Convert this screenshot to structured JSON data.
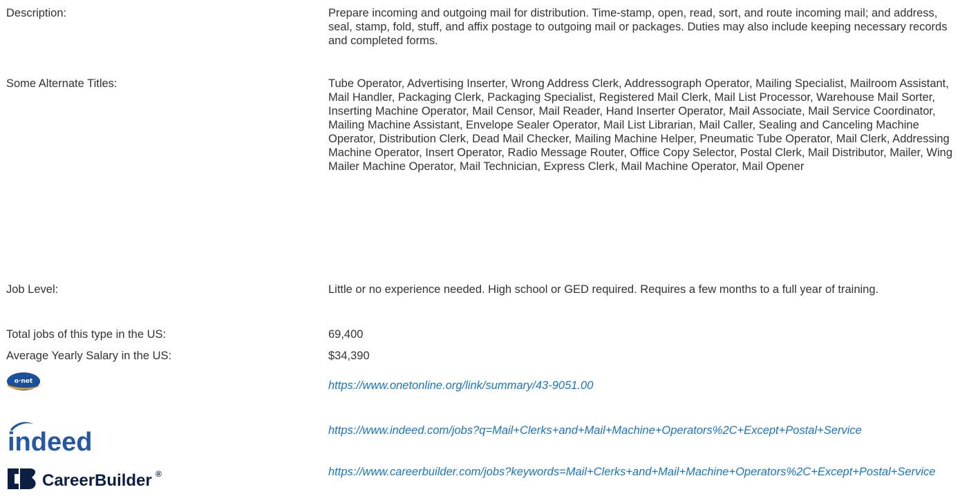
{
  "rows": {
    "description": {
      "label": "Description:",
      "value": "Prepare incoming and outgoing mail for distribution. Time-stamp, open, read, sort, and route incoming mail; and address, seal, stamp, fold, stuff, and affix postage to outgoing mail or packages. Duties may also include keeping necessary records and completed forms."
    },
    "alternate_titles": {
      "label": "Some Alternate Titles:",
      "value": "Tube Operator, Advertising Inserter, Wrong Address Clerk, Addressograph Operator, Mailing Specialist, Mailroom Assistant, Mail Handler, Packaging Clerk, Packaging Specialist, Registered Mail Clerk, Mail List Processor, Warehouse Mail Sorter, Inserting Machine Operator, Mail Censor, Mail Reader, Hand Inserter Operator, Mail Associate, Mail Service Coordinator, Mailing Machine Assistant, Envelope Sealer Operator, Mail List Librarian, Mail Caller, Sealing and Canceling Machine Operator, Distribution Clerk, Dead Mail Checker, Mailing Machine Helper, Pneumatic Tube Operator, Mail Clerk, Addressing Machine Operator, Insert Operator, Radio Message Router, Office Copy Selector, Postal Clerk, Mail Distributor, Mailer, Wing Mailer Machine Operator, Mail Technician, Express Clerk, Mail Machine Operator, Mail Opener"
    },
    "job_level": {
      "label": "Job Level:",
      "value": "Little or no experience needed. High school or GED required. Requires a few months to a full year of training."
    },
    "total_jobs": {
      "label": "Total jobs of this type in the US:",
      "value": "69,400"
    },
    "salary": {
      "label": "Average Yearly Salary in the US:",
      "value": "$34,390"
    }
  },
  "links": {
    "onet": {
      "logo_text": "o·net",
      "icon": "onet-logo",
      "url": "https://www.onetonline.org/link/summary/43-9051.00"
    },
    "indeed": {
      "logo_text": "indeed",
      "icon": "indeed-logo",
      "url": "https://www.indeed.com/jobs?q=Mail+Clerks+and+Mail+Machine+Operators%2C+Except+Postal+Service"
    },
    "careerbuilder": {
      "logo_text": "CareerBuilder",
      "logo_mark": "®",
      "icon": "careerbuilder-logo",
      "url": "https://www.careerbuilder.com/jobs?keywords=Mail+Clerks+and+Mail+Machine+Operators%2C+Except+Postal+Service"
    }
  },
  "colors": {
    "text": "#333333",
    "link": "#1b75bb",
    "indeed_blue": "#2557a7",
    "careerbuilder_navy": "#0b1f44",
    "onet_blue": "#1a4f9c",
    "onet_orange": "#f3a21b"
  }
}
